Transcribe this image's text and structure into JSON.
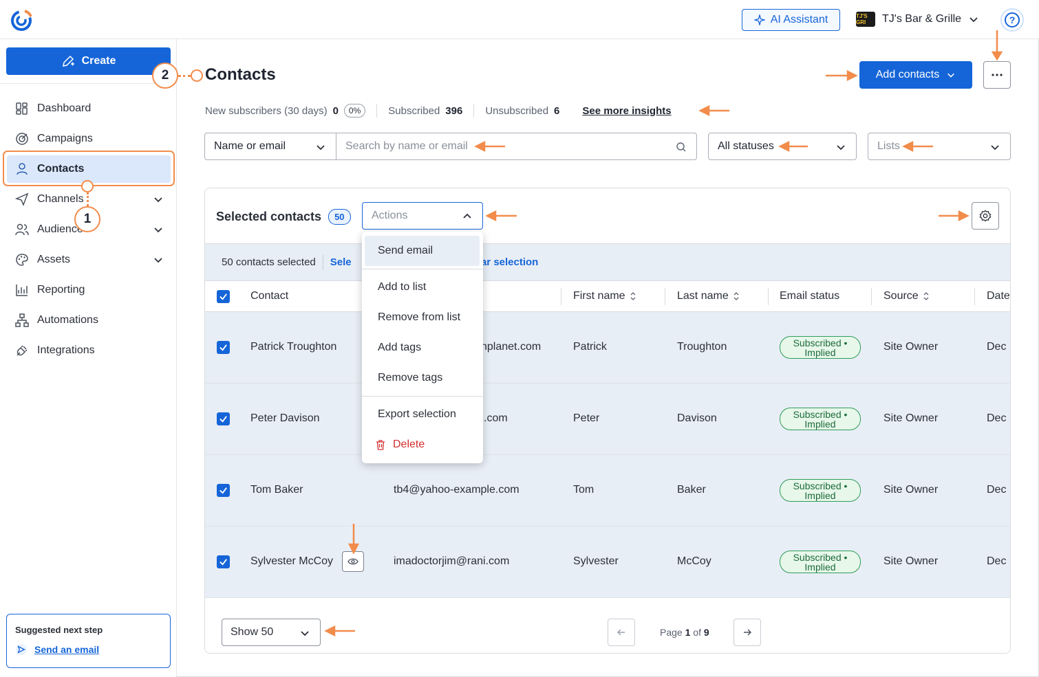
{
  "header": {
    "ai_assistant": "AI Assistant",
    "account_name": "TJ's Bar & Grille",
    "account_logo_text": "TJ'S GRI"
  },
  "sidebar": {
    "create_label": "Create",
    "items": [
      {
        "label": "Dashboard",
        "icon": "dashboard-icon"
      },
      {
        "label": "Campaigns",
        "icon": "campaigns-icon"
      },
      {
        "label": "Contacts",
        "icon": "person-icon",
        "active": true
      },
      {
        "label": "Channels",
        "icon": "send-icon"
      },
      {
        "label": "Audience",
        "icon": "people-icon"
      },
      {
        "label": "Assets",
        "icon": "palette-icon"
      },
      {
        "label": "Reporting",
        "icon": "chart-icon"
      },
      {
        "label": "Automations",
        "icon": "flow-icon"
      },
      {
        "label": "Integrations",
        "icon": "plug-icon"
      }
    ],
    "suggest_title": "Suggested next step",
    "suggest_link": "Send an email"
  },
  "callouts": {
    "one": "1",
    "two": "2"
  },
  "page": {
    "title": "Contacts",
    "add_contacts": "Add contacts"
  },
  "stats": {
    "new_label": "New subscribers (30 days)",
    "new_value": "0",
    "new_pct": "0%",
    "subscribed_label": "Subscribed",
    "subscribed_value": "396",
    "unsubscribed_label": "Unsubscribed",
    "unsubscribed_value": "6",
    "insights": "See more insights"
  },
  "filters": {
    "field_select": "Name or email",
    "search_placeholder": "Search by name or email",
    "status_select": "All statuses",
    "lists_placeholder": "Lists"
  },
  "table": {
    "selected_title": "Selected contacts",
    "selected_count": "50",
    "actions_placeholder": "Actions",
    "selection_summary": "50 contacts selected",
    "select_all_partial": "Sele",
    "clear_partial": "ear selection",
    "columns": [
      "Contact",
      "First name",
      "Last name",
      "Email status",
      "Source",
      "Date"
    ],
    "rows": [
      {
        "contact": "Patrick Troughton",
        "email": "hplanet.com",
        "first": "Patrick",
        "last": "Troughton",
        "status": "Subscribed • Implied",
        "source": "Site Owner",
        "date": "Dec"
      },
      {
        "contact": "Peter Davison",
        "email": ".com",
        "first": "Peter",
        "last": "Davison",
        "status": "Subscribed • Implied",
        "source": "Site Owner",
        "date": "Dec"
      },
      {
        "contact": "Tom Baker",
        "email": "tb4@yahoo-example.com",
        "first": "Tom",
        "last": "Baker",
        "status": "Subscribed • Implied",
        "source": "Site Owner",
        "date": "Dec"
      },
      {
        "contact": "Sylvester McCoy",
        "email": "imadoctorjim@rani.com",
        "first": "Sylvester",
        "last": "McCoy",
        "status": "Subscribed • Implied",
        "source": "Site Owner",
        "date": "Dec"
      }
    ],
    "show_select": "Show 50",
    "page_prefix": "Page",
    "page_current": "1",
    "page_of": "of",
    "page_total": "9"
  },
  "actions_menu": {
    "send_email": "Send email",
    "add_to_list": "Add to list",
    "remove_from_list": "Remove from list",
    "add_tags": "Add tags",
    "remove_tags": "Remove tags",
    "export_selection": "Export selection",
    "delete": "Delete"
  },
  "colors": {
    "primary": "#1565d8",
    "annotation": "#f28c4b",
    "success": "#2e9d57",
    "danger": "#d32f2f"
  }
}
